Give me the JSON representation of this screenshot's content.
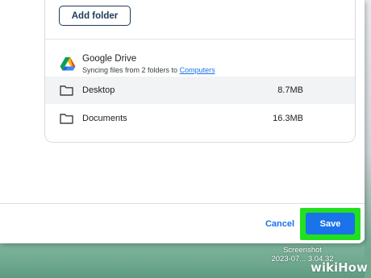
{
  "dialog": {
    "add_folder_label": "Add folder",
    "cancel_label": "Cancel",
    "save_label": "Save"
  },
  "drive": {
    "title": "Google Drive",
    "subtitle_prefix": "Syncing files from 2 folders to",
    "subtitle_link": "Computers",
    "folders": [
      {
        "name": "Desktop",
        "size": "8.7MB"
      },
      {
        "name": "Documents",
        "size": "16.3MB"
      }
    ]
  },
  "desktop": {
    "screenshot_label_line1": "Screenshot",
    "screenshot_label_line2": "2023-07... 3.04.32"
  },
  "watermark": "wikiHow",
  "colors": {
    "accent_blue": "#1a73e8",
    "highlight_green": "#22e01f",
    "button_border": "#1f3a57"
  },
  "icons": [
    "google-drive-icon",
    "folder-icon"
  ]
}
